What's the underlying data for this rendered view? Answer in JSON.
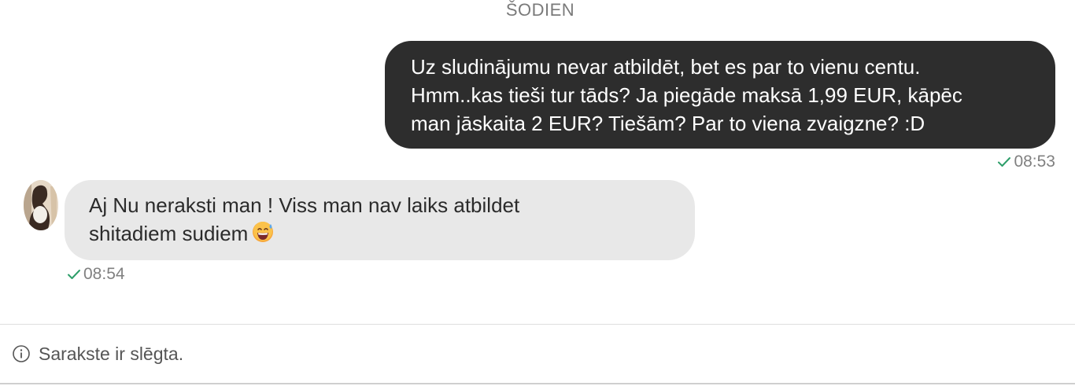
{
  "day_separator": "ŠODIEN",
  "messages": [
    {
      "direction": "outgoing",
      "lines": [
        "Uz sludinājumu nevar atbildēt, bet es par to vienu centu.",
        "Hmm..kas tieši tur tāds? Ja piegāde maksā 1,99 EUR, kāpēc",
        "man jāskaita 2 EUR? Tiešām? Par to viena zvaigzne? :D"
      ],
      "time": "08:53",
      "status_icon": "check-icon"
    },
    {
      "direction": "incoming",
      "lines": [
        "Aj Nu neraksti man ! Viss man nav laiks atbildet",
        "shitadiem sudiem"
      ],
      "emoji": "grinning-sweat-emoji",
      "time": "08:54",
      "status_icon": "check-icon"
    }
  ],
  "footer": {
    "icon": "info-icon",
    "text": "Sarakste ir slēgta."
  },
  "colors": {
    "outgoing_bubble": "#2d2d2d",
    "incoming_bubble": "#e8e8e8",
    "check": "#2e9e6a",
    "meta_text": "#808080"
  }
}
